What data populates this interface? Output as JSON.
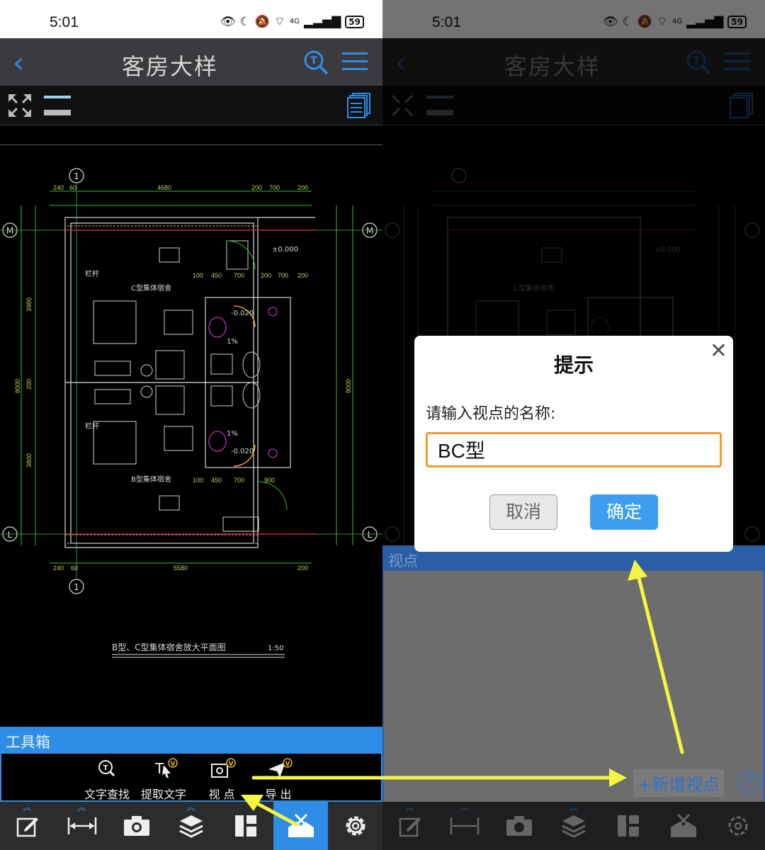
{
  "status": {
    "time": "5:01",
    "network": "4G",
    "battery": "59"
  },
  "header": {
    "title": "客房大样",
    "back_icon": "chevron-left-icon"
  },
  "drawing": {
    "caption": "B型、C型集体宿舍放大平面图",
    "scale": "1:50",
    "room_c_label": "C型集体宿舍",
    "room_b_label": "B型集体宿舍",
    "rail_label": "栏杆",
    "axis_1": "1",
    "axis_m": "M",
    "axis_l": "L",
    "dim_top": [
      "240",
      "60",
      "4680",
      "200",
      "700",
      "200"
    ],
    "dim_bottom": [
      "240",
      "60",
      "5580",
      "200"
    ],
    "dim_mid": [
      "100",
      "450",
      "700",
      "200",
      "700",
      "200"
    ],
    "dim_mid2": [
      "100",
      "450",
      "700",
      "900"
    ],
    "dim_left": [
      "3980",
      "8000",
      "200",
      "3800"
    ],
    "level": "±0.000",
    "slope": "1%",
    "drop": "-0.020"
  },
  "toolbox": {
    "title": "工具箱",
    "tools": [
      {
        "label": "文字查找",
        "icon": "text-search-icon"
      },
      {
        "label": "提取文字",
        "icon": "extract-text-icon"
      },
      {
        "label": "视  点",
        "icon": "viewpoint-icon"
      },
      {
        "label": "导  出",
        "icon": "export-icon"
      }
    ],
    "vip_badge": "V"
  },
  "viewpoint": {
    "title": "视点",
    "add_label": "+新增视点",
    "help_label": "?"
  },
  "dialog": {
    "title": "提示",
    "prompt": "请输入视点的名称:",
    "value": "BC型",
    "cancel": "取消",
    "ok": "确定"
  },
  "colors": {
    "accent": "#2e8de6",
    "input_border": "#f29a2a",
    "arrow": "#f5f542"
  }
}
